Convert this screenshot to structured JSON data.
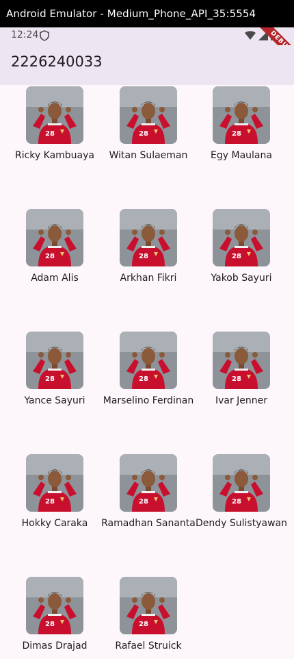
{
  "window": {
    "title": "Android Emulator - Medium_Phone_API_35:5554"
  },
  "status_bar": {
    "time": "12:24"
  },
  "debug_banner": "DEBUG",
  "app_bar": {
    "title": "2226240033"
  },
  "players": [
    {
      "name": "Ricky Kambuaya"
    },
    {
      "name": "Witan Sulaeman"
    },
    {
      "name": "Egy Maulana"
    },
    {
      "name": "Adam Alis"
    },
    {
      "name": "Arkhan Fikri"
    },
    {
      "name": "Yakob Sayuri"
    },
    {
      "name": "Yance Sayuri"
    },
    {
      "name": "Marselino Ferdinan"
    },
    {
      "name": "Ivar Jenner"
    },
    {
      "name": "Hokky Caraka"
    },
    {
      "name": "Ramadhan Sananta"
    },
    {
      "name": "Dendy Sulistyawan"
    },
    {
      "name": "Dimas Drajad"
    },
    {
      "name": "Rafael Struick"
    }
  ],
  "colors": {
    "app_bar": "#ede5f1",
    "background": "#fdf7fc",
    "jersey": "#c8102e",
    "debug": "#b4262c"
  }
}
